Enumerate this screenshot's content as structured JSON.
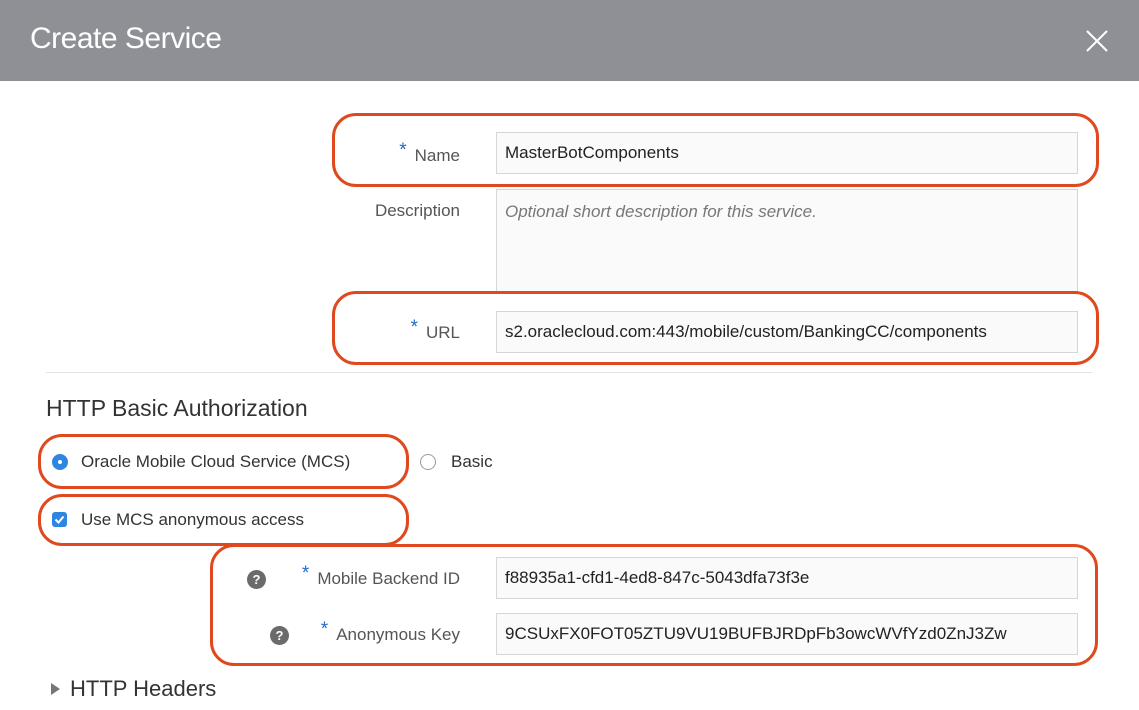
{
  "dialog": {
    "title": "Create Service",
    "close_icon": "close-icon"
  },
  "form": {
    "required_marker": "*",
    "name": {
      "label": "Name",
      "value": "MasterBotComponents"
    },
    "description": {
      "label": "Description",
      "placeholder": "Optional short description for this service."
    },
    "url": {
      "label": "URL",
      "value": "s2.oraclecloud.com:443/mobile/custom/BankingCC/components"
    }
  },
  "auth": {
    "section_title": "HTTP Basic Authorization",
    "options": [
      {
        "label": "Oracle Mobile Cloud Service (MCS)",
        "selected": true
      },
      {
        "label": "Basic",
        "selected": false
      }
    ],
    "anonymous_access": {
      "label": "Use MCS anonymous access",
      "checked": true
    },
    "help_glyph": "?",
    "mobile_backend_id": {
      "label": "Mobile Backend ID",
      "value": "f88935a1-cfd1-4ed8-847c-5043dfa73f3e"
    },
    "anonymous_key": {
      "label": "Anonymous Key",
      "value": "9CSUxFX0FOT05ZTU9VU19BUFBJRDpFb3owcWVfYzd0ZnJ3Zw"
    }
  },
  "headers_section": {
    "title": "HTTP Headers",
    "expanded": false
  },
  "colors": {
    "header": "#8e9096",
    "accent": "#2f86e0",
    "highlight": "#e0481d"
  }
}
